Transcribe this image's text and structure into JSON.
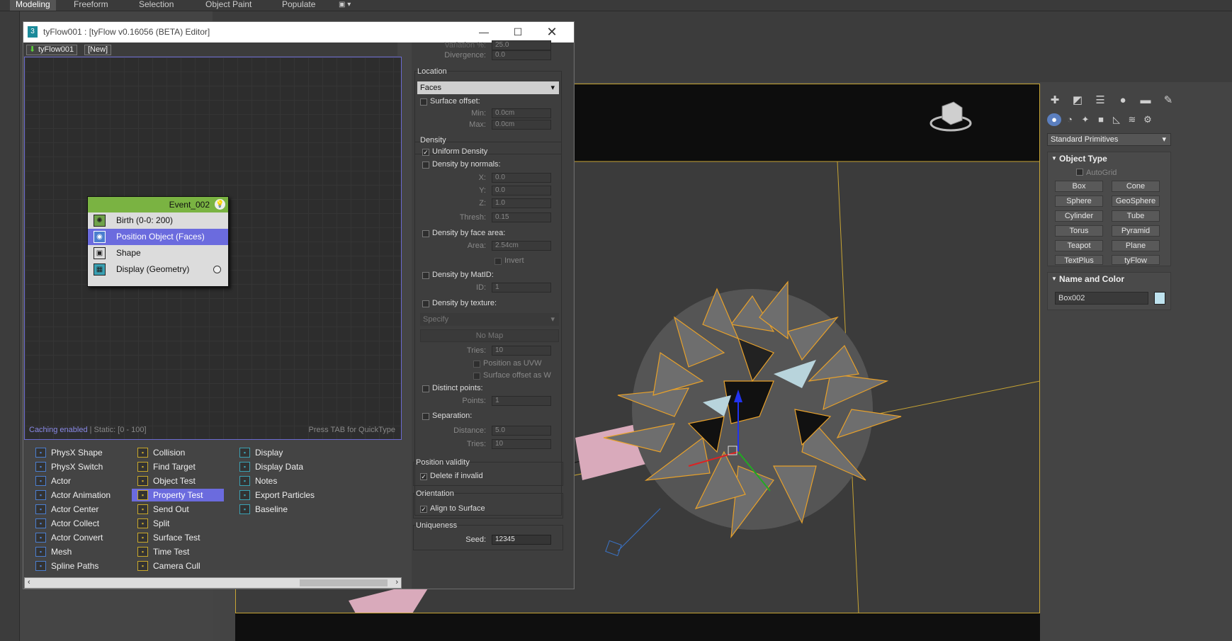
{
  "ribbon": {
    "tabs": [
      "Modeling",
      "Freeform",
      "Selection",
      "Object Paint",
      "Populate"
    ]
  },
  "window": {
    "title": "tyFlow001 : [tyFlow v0.16056 (BETA) Editor]"
  },
  "flow_tabs": [
    "tyFlow001",
    "[New]"
  ],
  "event": {
    "name": "Event_002",
    "operators": [
      "Birth (0-0: 200)",
      "Position Object (Faces)",
      "Shape",
      "Display (Geometry)"
    ]
  },
  "graph_status": {
    "caching": "Caching enabled",
    "static": "| Static: [0 - 100]",
    "hint": "Press TAB for QuickType"
  },
  "operator_list": {
    "col1": [
      "PhysX Shape",
      "PhysX Switch",
      "Actor",
      "Actor Animation",
      "Actor Center",
      "Actor Collect",
      "Actor Convert",
      "Mesh",
      "Spline Paths"
    ],
    "col2": [
      "Collision",
      "Find Target",
      "Object Test",
      "Property Test",
      "Send Out",
      "Split",
      "Surface Test",
      "Time Test",
      "Camera Cull"
    ],
    "col3": [
      "Display",
      "Display Data",
      "Notes",
      "Export Particles",
      "Baseline"
    ],
    "selected": "Property Test"
  },
  "params": {
    "variation_label": "Variation %:",
    "variation_value": "25.0",
    "divergence_label": "Divergence:",
    "divergence_value": "0.0",
    "location": {
      "title": "Location",
      "dropdown": "Faces",
      "surface_offset": "Surface offset:",
      "min_label": "Min:",
      "min_value": "0.0cm",
      "max_label": "Max:",
      "max_value": "0.0cm"
    },
    "density": {
      "title": "Density",
      "uniform": "Uniform Density",
      "by_normals": "Density by normals:",
      "x_label": "X:",
      "x_value": "0.0",
      "y_label": "Y:",
      "y_value": "0.0",
      "z_label": "Z:",
      "z_value": "1.0",
      "thresh_label": "Thresh:",
      "thresh_value": "0.15",
      "by_face_area": "Density by face area:",
      "area_label": "Area:",
      "area_value": "2.54cm",
      "invert": "Invert",
      "by_matid": "Density by MatID:",
      "id_label": "ID:",
      "id_value": "1",
      "by_texture": "Density by texture:",
      "specify": "Specify",
      "no_map": "No Map",
      "tries_label": "Tries:",
      "tries_value": "10",
      "pos_uvw": "Position as UVW",
      "surf_w": "Surface offset as W",
      "distinct": "Distinct points:",
      "points_label": "Points:",
      "points_value": "1",
      "separation": "Separation:",
      "distance_label": "Distance:",
      "distance_value": "5.0",
      "tries2_label": "Tries:",
      "tries2_value": "10"
    },
    "validity": {
      "title": "Position validity",
      "delete": "Delete if invalid"
    },
    "orientation": {
      "title": "Orientation",
      "align": "Align to Surface"
    },
    "uniqueness": {
      "title": "Uniqueness",
      "seed_label": "Seed:",
      "seed_value": "12345"
    }
  },
  "cmd": {
    "category": "Standard Primitives",
    "object_type_title": "Object Type",
    "autogrid": "AutoGrid",
    "buttons": [
      "Box",
      "Cone",
      "Sphere",
      "GeoSphere",
      "Cylinder",
      "Tube",
      "Torus",
      "Pyramid",
      "Teapot",
      "Plane",
      "TextPlus",
      "tyFlow"
    ],
    "name_color_title": "Name and Color",
    "object_name": "Box002",
    "object_color": "#bfe3ef"
  },
  "colors": {
    "accent": "#6b6bde",
    "event_header": "#7ab342",
    "viewport_frame": "#c8a534",
    "spike_edge": "#e8a12a"
  }
}
